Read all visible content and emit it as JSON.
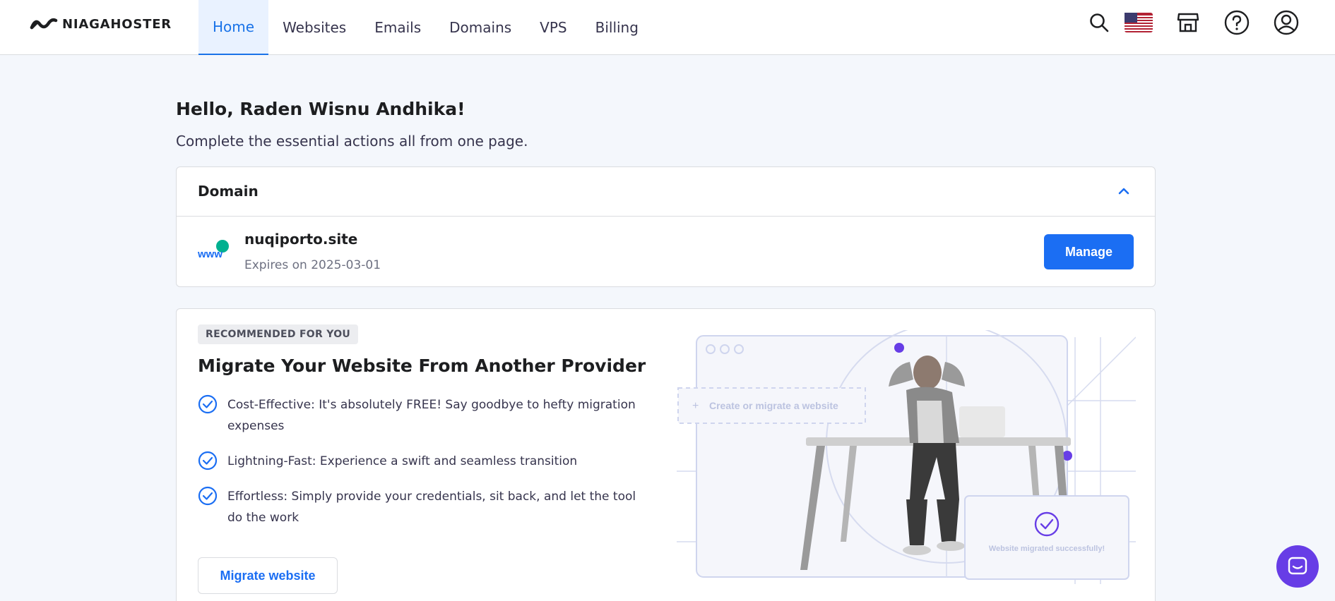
{
  "brand": {
    "name": "NIAGAHOSTER"
  },
  "nav": {
    "items": [
      {
        "label": "Home",
        "active": true
      },
      {
        "label": "Websites",
        "active": false
      },
      {
        "label": "Emails",
        "active": false
      },
      {
        "label": "Domains",
        "active": false
      },
      {
        "label": "VPS",
        "active": false
      },
      {
        "label": "Billing",
        "active": false
      }
    ]
  },
  "header_icons": [
    "search-icon",
    "us-flag-icon",
    "store-icon",
    "help-icon",
    "account-icon"
  ],
  "greeting": {
    "title": "Hello, Raden Wisnu Andhika!",
    "subtitle": "Complete the essential actions all from one page."
  },
  "domain_card": {
    "title": "Domain",
    "domain_name": "nuqiporto.site",
    "expires": "Expires on 2025-03-01",
    "manage_label": "Manage"
  },
  "recommend": {
    "badge": "RECOMMENDED FOR YOU",
    "title": "Migrate Your Website From Another Provider",
    "bullets": [
      "Cost-Effective: It's absolutely FREE! Say goodbye to hefty migration expenses",
      "Lightning-Fast: Experience a swift and seamless transition",
      "Effortless: Simply provide your credentials, sit back, and let the tool do the work"
    ],
    "button_label": "Migrate website",
    "illustration": {
      "create_label": "Create or migrate a website",
      "success_label": "Website migrated successfully!"
    }
  },
  "colors": {
    "primary": "#1b6ef3",
    "nav_active_bg": "#e9f2ff",
    "purple": "#673de6",
    "page_bg": "#f4f7fc"
  }
}
